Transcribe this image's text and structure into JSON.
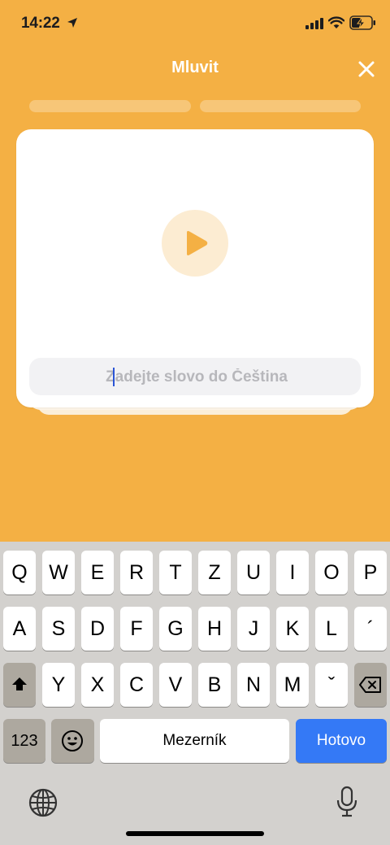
{
  "status": {
    "time": "14:22"
  },
  "header": {
    "title": "Mluvit"
  },
  "progress": [
    0,
    0
  ],
  "input": {
    "placeholder": "Zadejte slovo do Čeština",
    "value": ""
  },
  "keyboard": {
    "row1": [
      "Q",
      "W",
      "E",
      "R",
      "T",
      "Z",
      "U",
      "I",
      "O",
      "P"
    ],
    "row2": [
      "A",
      "S",
      "D",
      "F",
      "G",
      "H",
      "J",
      "K",
      "L",
      "´"
    ],
    "row3": [
      "Y",
      "X",
      "C",
      "V",
      "B",
      "N",
      "M",
      "ˇ"
    ],
    "numbers_label": "123",
    "space_label": "Mezerník",
    "done_label": "Hotovo"
  },
  "colors": {
    "background": "#F4B044",
    "accent_blue": "#3479F6",
    "play": "#F4B044"
  }
}
